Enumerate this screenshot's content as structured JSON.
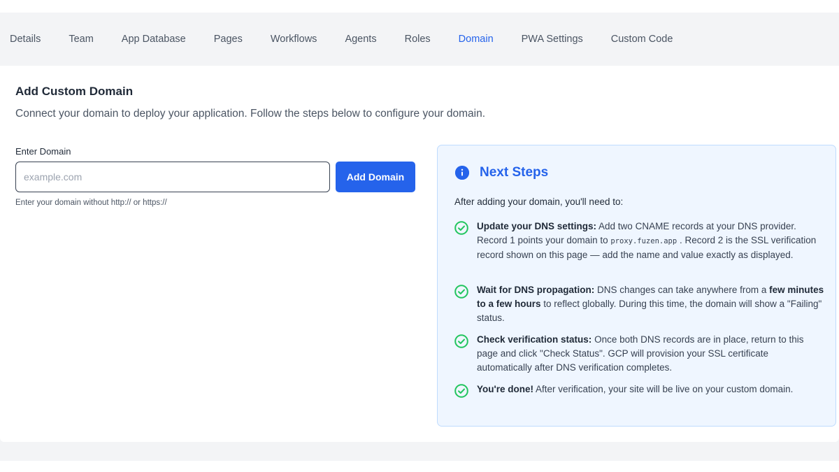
{
  "tabs": [
    {
      "label": "Details",
      "active": false
    },
    {
      "label": "Team",
      "active": false
    },
    {
      "label": "App Database",
      "active": false
    },
    {
      "label": "Pages",
      "active": false
    },
    {
      "label": "Workflows",
      "active": false
    },
    {
      "label": "Agents",
      "active": false
    },
    {
      "label": "Roles",
      "active": false
    },
    {
      "label": "Domain",
      "active": true
    },
    {
      "label": "PWA Settings",
      "active": false
    },
    {
      "label": "Custom Code",
      "active": false
    }
  ],
  "page": {
    "title": "Add Custom Domain",
    "subtitle": "Connect your domain to deploy your application. Follow the steps below to configure your domain."
  },
  "form": {
    "label": "Enter Domain",
    "placeholder": "example.com",
    "value": "",
    "button_label": "Add Domain",
    "hint": "Enter your domain without http:// or https://"
  },
  "next_steps": {
    "icon": "info-icon",
    "title": "Next Steps",
    "intro": "After adding your domain, you'll need to:",
    "steps": [
      {
        "icon": "check-circle-icon",
        "heading": "Update your DNS settings:",
        "text_a": " Add two CNAME records at your DNS provider. Record 1 points your domain to ",
        "code": "proxy.fuzen.app",
        "text_b": " . Record 2 is the SSL verification record shown on this page — add the name and value exactly as displayed."
      },
      {
        "icon": "check-circle-icon",
        "heading": "Wait for DNS propagation:",
        "text_a": " DNS changes can take anywhere from a ",
        "emphasis": "few minutes to a few hours",
        "text_b": " to reflect globally. During this time, the domain will show a \"Failing\" status."
      },
      {
        "icon": "check-circle-icon",
        "heading": "Check verification status:",
        "text_a": " Once both DNS records are in place, return to this page and click \"Check Status\". GCP will provision your SSL certificate automatically after DNS verification completes."
      },
      {
        "icon": "check-circle-icon",
        "heading": "You're done!",
        "text_a": " After verification, your site will be live on your custom domain."
      }
    ]
  },
  "colors": {
    "accent": "#2563eb",
    "success": "#22c55e",
    "info_bg": "#eff6ff",
    "info_border": "#bfdbfe"
  }
}
